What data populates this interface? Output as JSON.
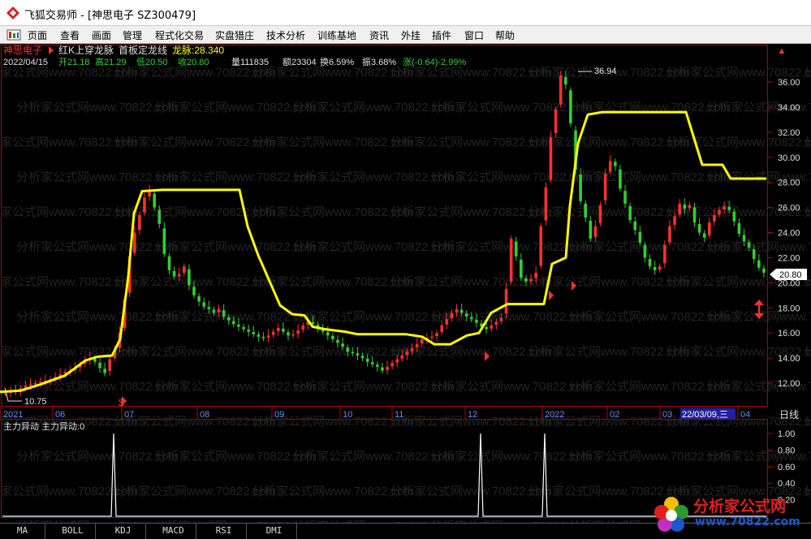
{
  "window": {
    "title": "飞狐交易师 - [神思电子 SZ300479]"
  },
  "menu": [
    "页面",
    "查看",
    "画面",
    "管理",
    "程式化交易",
    "实盘猎庄",
    "技术分析",
    "训练基地",
    "资讯",
    "外挂",
    "插件",
    "窗口",
    "帮助"
  ],
  "info": {
    "stock_name": "神思电子",
    "indicator_title": "红K上穿龙脉",
    "line_name": "首板定龙线",
    "line_value_label": "龙脉:28.340",
    "date": "2022/04/15",
    "open": "开21.18",
    "high": "高21.29",
    "low": "低20.50",
    "close": "收20.80",
    "volume": "量111835",
    "amount": "额23304",
    "turnover": "换6.59%",
    "amplitude": "振3.68%",
    "change": "涨(-0.64)-2.99%"
  },
  "labels": {
    "max": "36.94",
    "min": "10.75",
    "last_price": "20.80",
    "period": "日线",
    "cursor_date": "22/03/09,三",
    "lower_title": "主力异动 主力异动:0"
  },
  "tabs": [
    "MA",
    "BOLL",
    "KDJ",
    "MACD",
    "RSI",
    "DMI"
  ],
  "watermark": {
    "text": "分析家公式网",
    "url": "www.70822.com"
  },
  "colors": {
    "up": "#ff3030",
    "down": "#30d030",
    "line": "#ffff00",
    "axis": "#b00000",
    "grid": "#b00000"
  },
  "chart_data": [
    {
      "type": "candlestick",
      "title": "",
      "ylim": [
        10,
        37
      ],
      "y_ticks": [
        "12.00",
        "14.00",
        "16.00",
        "18.00",
        "20.00",
        "22.00",
        "24.00",
        "26.00",
        "28.00",
        "30.00",
        "32.00",
        "34.00",
        "36.00"
      ],
      "x_ticks": [
        "2021",
        "06",
        "07",
        "08",
        "09",
        "10",
        "11",
        "12",
        "2022",
        "02",
        "03",
        "04"
      ],
      "series": [
        {
          "name": "龙脉",
          "values": [
            [
              0,
              11.3
            ],
            [
              25,
              11.4
            ],
            [
              50,
              11.9
            ],
            [
              80,
              12.6
            ],
            [
              105,
              13.8
            ],
            [
              120,
              14.1
            ],
            [
              138,
              14.2
            ],
            [
              148,
              15.5
            ],
            [
              158,
              20.5
            ],
            [
              165,
              25.5
            ],
            [
              175,
              27.3
            ],
            [
              200,
              27.4
            ],
            [
              262,
              27.4
            ],
            [
              295,
              27.4
            ],
            [
              305,
              24.5
            ],
            [
              318,
              22.2
            ],
            [
              345,
              18.2
            ],
            [
              360,
              17.5
            ],
            [
              375,
              17.4
            ],
            [
              385,
              16.5
            ],
            [
              400,
              16.3
            ],
            [
              425,
              16.1
            ],
            [
              440,
              15.9
            ],
            [
              500,
              15.9
            ],
            [
              520,
              15.7
            ],
            [
              535,
              15.1
            ],
            [
              555,
              15.1
            ],
            [
              575,
              15.8
            ],
            [
              590,
              16.0
            ],
            [
              605,
              17.6
            ],
            [
              625,
              18.3
            ],
            [
              670,
              18.3
            ],
            [
              680,
              21.5
            ],
            [
              697,
              22.0
            ],
            [
              702,
              26.1
            ],
            [
              712,
              31.1
            ],
            [
              724,
              33.4
            ],
            [
              742,
              33.6
            ],
            [
              845,
              33.6
            ],
            [
              865,
              29.4
            ],
            [
              890,
              29.4
            ],
            [
              900,
              28.3
            ],
            [
              944,
              28.3
            ]
          ]
        },
        {
          "name": "price",
          "values": [
            11.2,
            11.4,
            11.3,
            11.6,
            11.8,
            11.9,
            12.0,
            12.1,
            12.2,
            12.3,
            12.5,
            12.7,
            12.9,
            13.0,
            13.2,
            13.5,
            13.8,
            14.0,
            13.7,
            13.2,
            12.8,
            13.9,
            14.6,
            16.0,
            18.7,
            22.1,
            24.0,
            25.4,
            26.8,
            27.3,
            26.0,
            24.7,
            22.3,
            21.0,
            20.5,
            20.7,
            21.3,
            19.8,
            19.0,
            18.5,
            18.1,
            17.9,
            17.6,
            17.9,
            17.3,
            17.0,
            16.7,
            16.5,
            16.3,
            16.1,
            15.9,
            15.7,
            15.6,
            15.8,
            16.1,
            16.4,
            16.1,
            15.8,
            15.9,
            16.2,
            16.6,
            16.9,
            16.7,
            16.4,
            16.1,
            15.8,
            15.5,
            15.2,
            14.9,
            14.5,
            14.4,
            14.2,
            14.0,
            13.7,
            13.5,
            13.3,
            13.0,
            13.3,
            13.6,
            13.9,
            14.2,
            14.5,
            14.8,
            15.1,
            15.5,
            15.6,
            15.7,
            16.0,
            16.6,
            17.1,
            17.6,
            17.9,
            17.6,
            17.3,
            17.1,
            16.8,
            16.5,
            16.3,
            16.6,
            16.9,
            17.2,
            19.5,
            23.5,
            22.1,
            20.4,
            20.1,
            20.3,
            20.8,
            24.5,
            27.6,
            31.6,
            33.8,
            36.5,
            35.8,
            32.7,
            29.0,
            26.5,
            25.2,
            23.5,
            24.5,
            26.2,
            28.7,
            29.7,
            29.3,
            27.5,
            26.3,
            25.0,
            24.2,
            23.2,
            22.0,
            21.3,
            21.0,
            21.3,
            23.0,
            24.5,
            25.3,
            26.3,
            25.9,
            26.2,
            24.8,
            24.0,
            23.6,
            24.8,
            25.4,
            25.8,
            26.1,
            25.8,
            24.9,
            23.9,
            23.3,
            22.8,
            21.9,
            21.2,
            20.8
          ]
        }
      ]
    },
    {
      "type": "line",
      "title": "主力异动",
      "ylim": [
        0,
        1
      ],
      "y_ticks": [
        "0.20",
        "0.40",
        "0.60",
        "0.80",
        "1.00"
      ],
      "series": [
        {
          "name": "主力异动",
          "spikes": [
            140,
            592,
            671
          ]
        }
      ]
    }
  ]
}
